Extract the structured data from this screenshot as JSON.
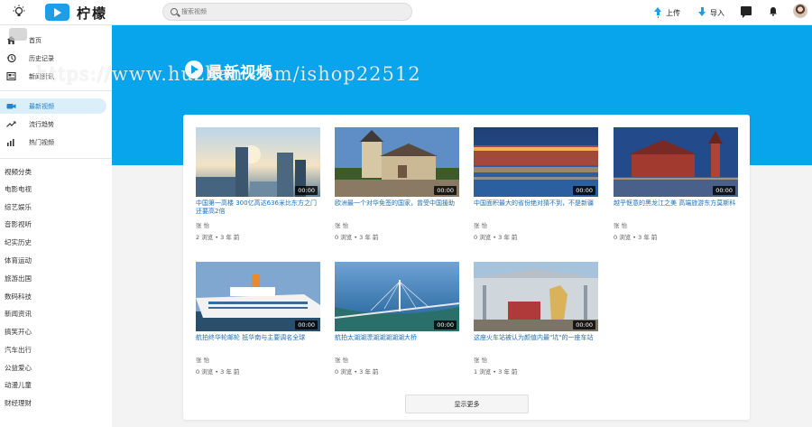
{
  "header": {
    "logo_text": "柠檬",
    "search_placeholder": "搜索视频",
    "upload_label": "上传",
    "import_label": "导入"
  },
  "sidebar": {
    "nav": [
      {
        "label": "首页",
        "icon": "home-icon"
      },
      {
        "label": "历史记录",
        "icon": "history-icon"
      },
      {
        "label": "新闻资讯",
        "icon": "news-icon"
      },
      {
        "label": "最新视频",
        "icon": "video-icon",
        "active": true
      },
      {
        "label": "流行趋势",
        "icon": "trending-icon"
      },
      {
        "label": "热门视频",
        "icon": "chart-icon"
      }
    ],
    "category_title": "视频分类",
    "categories": [
      "电影电视",
      "综艺娱乐",
      "音影视听",
      "纪实历史",
      "体育运动",
      "旅游出国",
      "数码科技",
      "新闻资讯",
      "搞笑开心",
      "汽车出行",
      "公益爱心",
      "动漫儿童",
      "财经理财"
    ]
  },
  "banner": {
    "title": "最新视频",
    "watermark": "https://www.huzhan.com/ishop22512"
  },
  "videos": [
    {
      "title": "中国第一高楼 300亿高达636米比东方之门还要高2倍",
      "author": "张 怡",
      "meta": "2 浏览 • 3 年 前",
      "duration": "00:00"
    },
    {
      "title": "欧洲最一个对华免签的国家，曾受中国援助",
      "author": "张 怡",
      "meta": "0 浏览 • 3 年 前",
      "duration": "00:00"
    },
    {
      "title": "中国面积最大的省份绝对猜不到，不是新疆",
      "author": "张 怡",
      "meta": "0 浏览 • 3 年 前",
      "duration": "00:00"
    },
    {
      "title": "越乎惬意的黑龙江之美 高端旅游东方莫斯科",
      "author": "张 怡",
      "meta": "0 浏览 • 3 年 前",
      "duration": "00:00"
    },
    {
      "title": "航拍终华轮邮轮 抵华南与主要调名全球",
      "author": "张 怡",
      "meta": "0 浏览 • 3 年 前",
      "duration": "00:00"
    },
    {
      "title": "航拍太湖湖漂湖湖湖湖湖大桥",
      "author": "张 怡",
      "meta": "0 浏览 • 3 年 前",
      "duration": "00:00"
    },
    {
      "title": "这座火车站被认为颜值内最\"坑\"的一座车站",
      "author": "张 怡",
      "meta": "1 浏览 • 3 年 前",
      "duration": "00:00"
    }
  ],
  "show_more_label": "显示更多"
}
